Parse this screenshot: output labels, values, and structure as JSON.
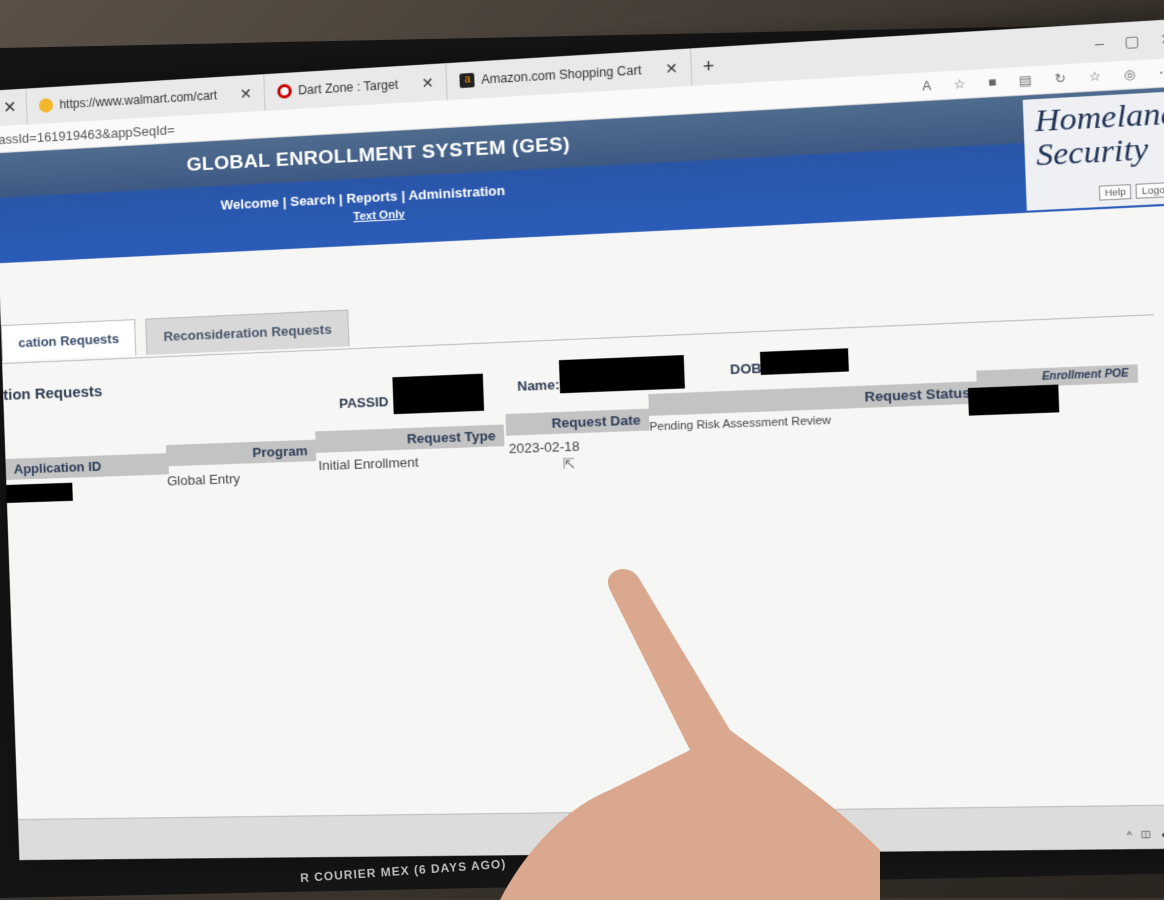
{
  "browser": {
    "tabs": [
      {
        "label": "",
        "icon": "close-icon"
      },
      {
        "label": "https://www.walmart.com/cart",
        "icon": "walmart-icon"
      },
      {
        "label": "Dart Zone : Target",
        "icon": "target-icon"
      },
      {
        "label": "Amazon.com Shopping Cart",
        "icon": "amazon-icon"
      }
    ],
    "new_tab": "+",
    "address": "assId=161919463&appSeqId="
  },
  "header": {
    "title": "GLOBAL ENROLLMENT SYSTEM (GES)",
    "nav": [
      "Welcome",
      "Search",
      "Reports",
      "Administration"
    ],
    "text_only": "Text Only",
    "logo_line1": "Homeland",
    "logo_line2": "Security",
    "help": "Help",
    "logout": "Logout"
  },
  "tabs": [
    {
      "label": "cation Requests"
    },
    {
      "label": "Reconsideration Requests"
    }
  ],
  "section_title": "tion Requests",
  "fields": {
    "passid_label": "PASSID",
    "name_label": "Name:",
    "dob_label": "DOB:"
  },
  "table": {
    "columns": [
      "Application ID",
      "Program",
      "Request Type",
      "Request Date",
      "Request Status",
      "Enrollment POE"
    ],
    "rows": [
      {
        "application_id": "",
        "program": "Global Entry",
        "request_type": "Initial Enrollment",
        "request_date": "2023-02-18",
        "request_status": "Pending Risk Assessment Review",
        "enrollment_poe": ""
      }
    ]
  },
  "below_screen_text": "R COURIER MEX (6 DAYS AGO)"
}
